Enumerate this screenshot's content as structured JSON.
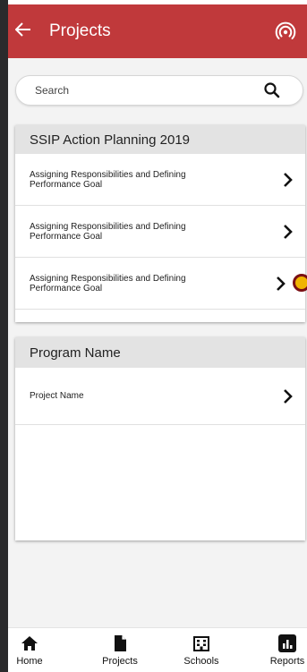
{
  "header": {
    "title": "Projects"
  },
  "search": {
    "placeholder": "Search"
  },
  "sections": [
    {
      "title": "SSIP Action Planning 2019",
      "items": [
        {
          "label": "Assigning Responsibilities and Defining Performance Goal"
        },
        {
          "label": "Assigning Responsibilities and Defining Performance Goal"
        },
        {
          "label": "Assigning Responsibilities and Defining Performance Goal"
        }
      ]
    },
    {
      "title": "Program Name",
      "items": [
        {
          "label": "Project Name"
        }
      ]
    }
  ],
  "nav": {
    "items": [
      {
        "label": "Home",
        "icon": "home-icon"
      },
      {
        "label": "Projects",
        "icon": "document-icon"
      },
      {
        "label": "Schools",
        "icon": "building-icon"
      },
      {
        "label": "Reports",
        "icon": "bar-chart-icon"
      }
    ]
  },
  "colors": {
    "appbar": "#c0393b",
    "dot_fill": "#f0b400",
    "dot_ring": "#7a0f14"
  }
}
